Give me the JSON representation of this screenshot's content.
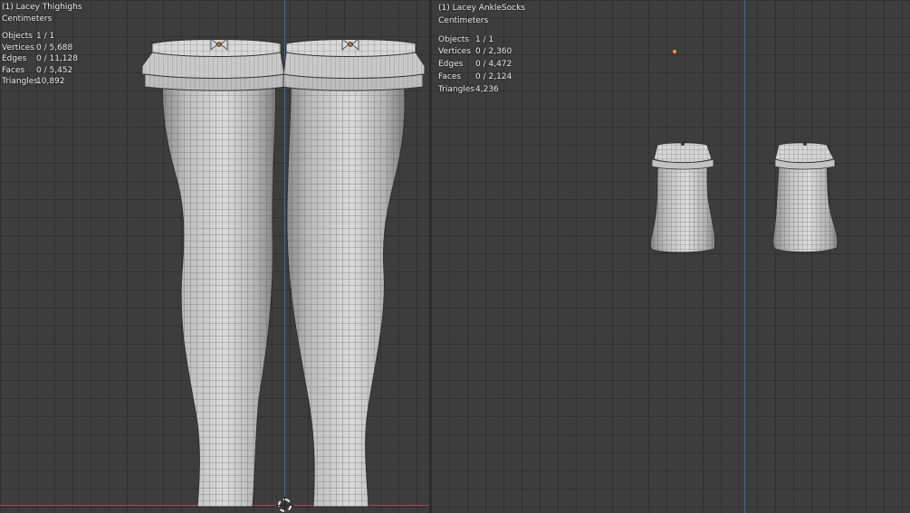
{
  "left_viewport": {
    "object_name": "(1) Lacey Thighighs",
    "units": "Centimeters",
    "stats": [
      {
        "label": "Objects",
        "value": "1 / 1"
      },
      {
        "label": "Vertices",
        "value": "0 / 5,688"
      },
      {
        "label": "Edges",
        "value": "0 / 11,128"
      },
      {
        "label": "Faces",
        "value": "0 / 5,452"
      },
      {
        "label": "Triangles",
        "value": "10,892"
      }
    ]
  },
  "right_viewport": {
    "object_name": "(1) Lacey AnkleSocks",
    "units": "Centimeters",
    "stats": [
      {
        "label": "Objects",
        "value": "1 / 1"
      },
      {
        "label": "Vertices",
        "value": "0 / 2,360"
      },
      {
        "label": "Edges",
        "value": "0 / 4,472"
      },
      {
        "label": "Faces",
        "value": "0 / 2,124"
      },
      {
        "label": "Triangles",
        "value": "4,236"
      }
    ]
  },
  "colors": {
    "grid_background": "#3d3d3d",
    "x_axis": "#b34a5b",
    "z_axis": "#3f6eb6",
    "mesh_fill": "#c8c8c8",
    "mesh_wire": "#4e4e4e",
    "origin": "#ff9a2a"
  },
  "icons": {
    "bow": "bow-icon",
    "cursor": "3d-cursor-icon"
  }
}
